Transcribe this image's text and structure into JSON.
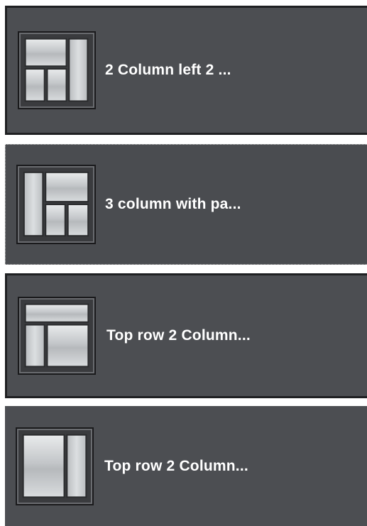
{
  "layouts": [
    {
      "label": "2 Column left 2 ...",
      "icon": "layout-2col-left-icon"
    },
    {
      "label": "3 column with pa...",
      "icon": "layout-3col-icon"
    },
    {
      "label": "Top row 2 Column...",
      "icon": "layout-top-row-2col-icon"
    },
    {
      "label": "Top row 2 Column...",
      "icon": "layout-2col-icon"
    }
  ],
  "colors": {
    "item_bg": "#4c4e52",
    "item_border": "#1f2022",
    "label_text": "#ffffff",
    "panel_fill": "#c9ccce"
  }
}
